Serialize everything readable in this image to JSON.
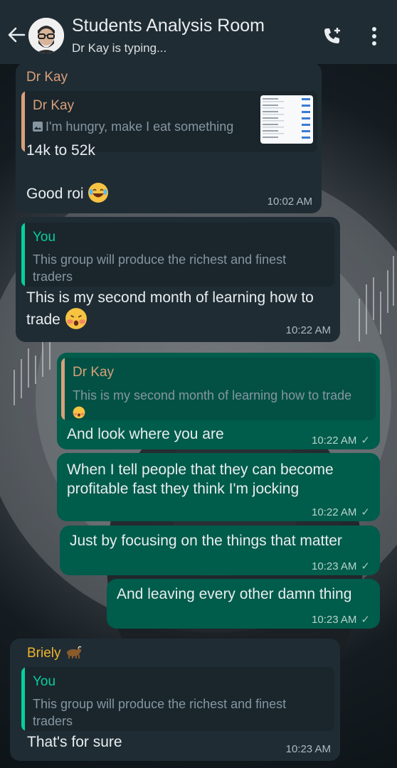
{
  "header": {
    "title": "Students Analysis Room",
    "status": "Dr Kay is typing..."
  },
  "colors": {
    "header_bg": "#1f2c34",
    "incoming_bubble": "#1f2c34",
    "outgoing_bubble": "#005c4b",
    "accent_drkay": "#d9a07b",
    "accent_you": "#06cf9c",
    "accent_briely": "#f0b429"
  },
  "messages": [
    {
      "sender": "Dr Kay",
      "quote_author": "Dr Kay",
      "quote_text": "I'm hungry, make I eat something",
      "text_line1": "14k to 52k",
      "text_line2": "Good roi",
      "time": "10:02 AM"
    },
    {
      "quote_author": "You",
      "quote_text": "This group will produce the richest and finest traders",
      "text": "This is my second month of learning how to trade",
      "time": "10:22 AM"
    },
    {
      "quote_author": "Dr Kay",
      "quote_text": "This is my second month of learning how to trade",
      "text": "And look where you are",
      "time": "10:22 AM"
    },
    {
      "text": "When I tell people that they can become profitable fast they think I'm jocking",
      "time": "10:22 AM"
    },
    {
      "text": "Just by focusing on the things that matter",
      "time": "10:23 AM"
    },
    {
      "text": "And leaving every other damn thing",
      "time": "10:23 AM"
    },
    {
      "sender": "Briely",
      "quote_author": "You",
      "quote_text": "This group will produce the richest and finest traders",
      "text": "That's for sure",
      "time": "10:23 AM"
    }
  ]
}
